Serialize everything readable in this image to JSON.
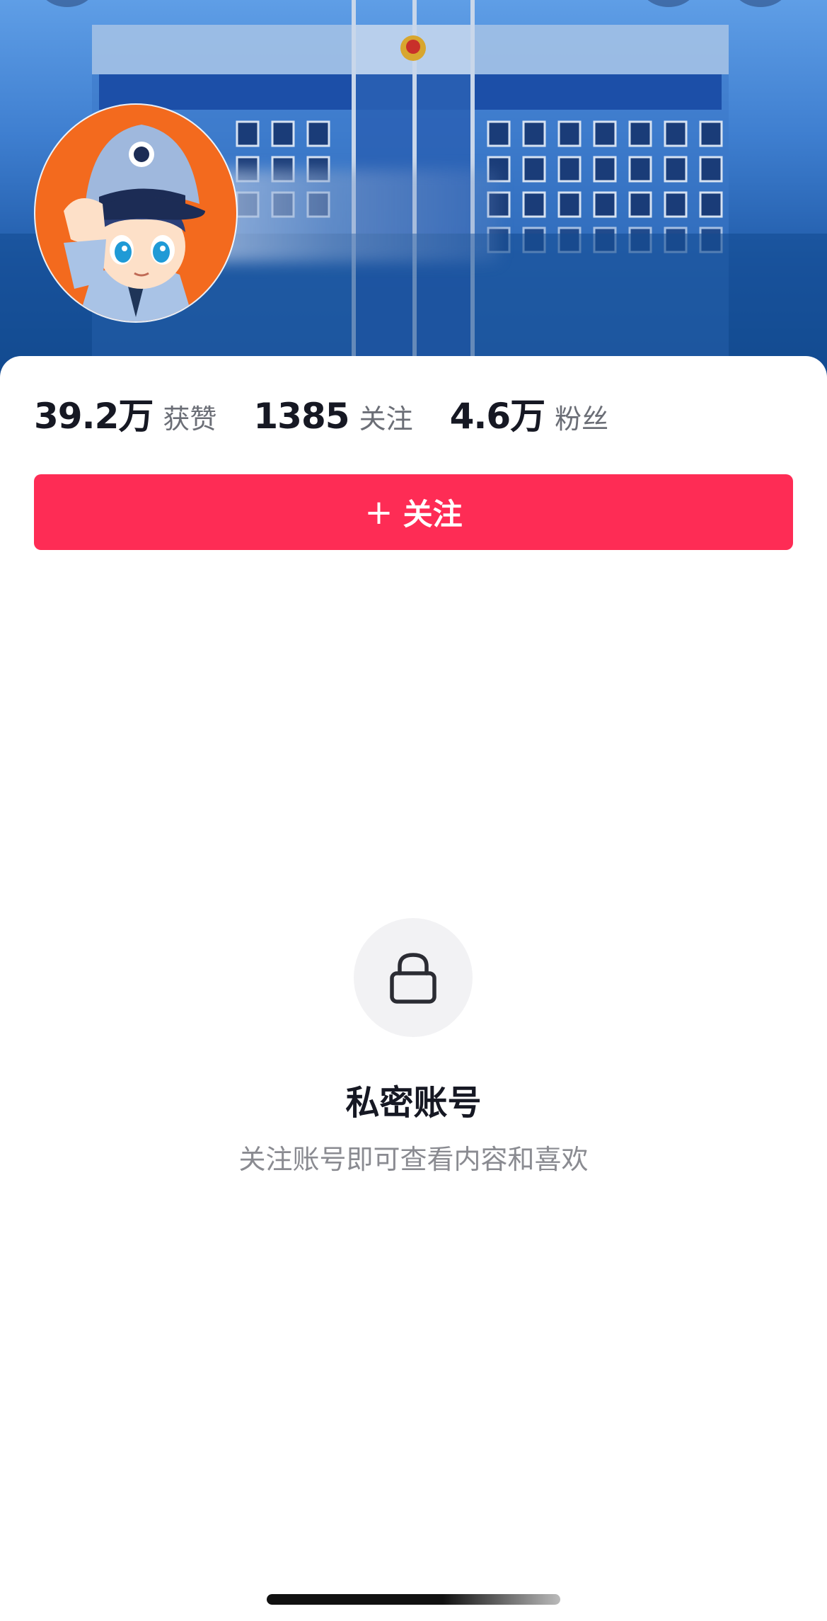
{
  "header": {
    "icons": {
      "back": "back-arrow-icon",
      "search": "search-icon",
      "more": "more-icon"
    },
    "avatar": "police-mascot-avatar",
    "name_blurred": true
  },
  "stats": [
    {
      "value": "39.2万",
      "label": "获赞"
    },
    {
      "value": "1385",
      "label": "关注"
    },
    {
      "value": "4.6万",
      "label": "粉丝"
    }
  ],
  "follow_button": {
    "plus": "+",
    "label": "关注"
  },
  "private": {
    "icon": "lock-icon",
    "title": "私密账号",
    "subtitle": "关注账号即可查看内容和喜欢"
  },
  "colors": {
    "accent": "#fe2c55",
    "text_primary": "#161823",
    "text_secondary": "#6b6e76",
    "cover_blue": "#1f5aa8"
  }
}
